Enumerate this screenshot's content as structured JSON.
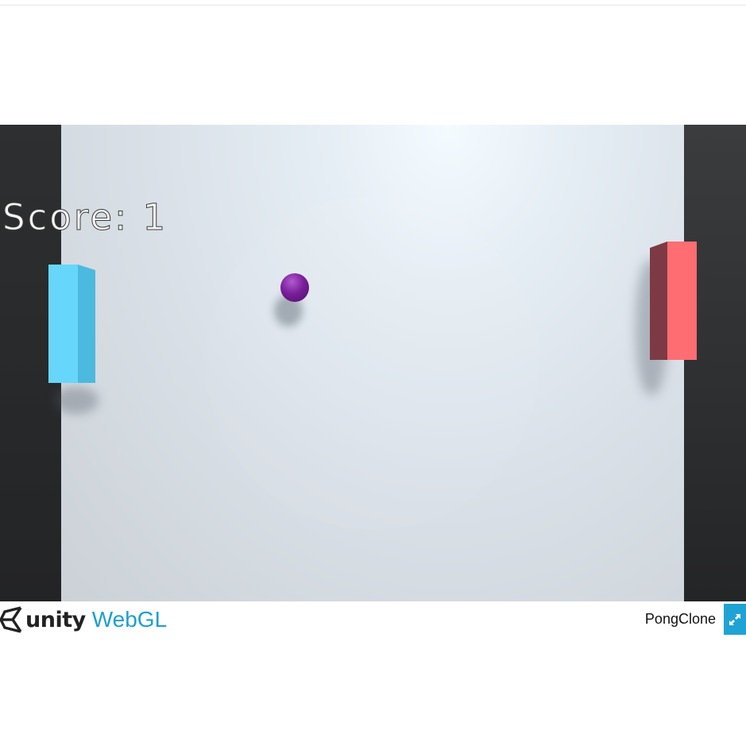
{
  "game": {
    "score_text": "Score: 1"
  },
  "footer": {
    "unity_label": "unity",
    "webgl_label": "WebGL",
    "game_title": "PongClone"
  },
  "colors": {
    "left_paddle": "#66d7fb",
    "right_paddle": "#fd6d72",
    "ball": "#7a1f9b",
    "webgl_accent": "#1b9fd3",
    "fullscreen_button": "#1fa3d4"
  },
  "icons": {
    "unity_logo": "unity-cube-icon",
    "fullscreen": "expand-arrows-icon"
  }
}
